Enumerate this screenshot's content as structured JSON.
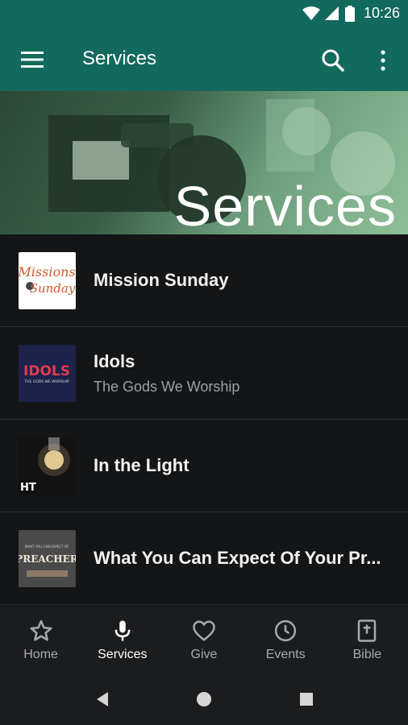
{
  "status_bar": {
    "time": "10:26"
  },
  "app_bar": {
    "title": "Services"
  },
  "hero": {
    "title": "Services"
  },
  "services": [
    {
      "title": "Mission Sunday",
      "subtitle": "",
      "thumb_text": "Missions Sunday",
      "thumb_bg": "#ffffff"
    },
    {
      "title": "Idols",
      "subtitle": "The Gods We Worship",
      "thumb_text": "IDOLS",
      "thumb_sub": "THE GODS WE WORSHIP",
      "thumb_bg": "#1c2249"
    },
    {
      "title": "In the Light",
      "subtitle": "",
      "thumb_text": "HT",
      "thumb_bg": "#121212"
    },
    {
      "title": "What You Can Expect Of Your Pr...",
      "subtitle": "",
      "thumb_text": "PREACHER",
      "thumb_bg": "#3a3a3a"
    }
  ],
  "bottom_nav": [
    {
      "label": "Home",
      "icon": "star-icon",
      "active": false
    },
    {
      "label": "Services",
      "icon": "microphone-icon",
      "active": true
    },
    {
      "label": "Give",
      "icon": "heart-icon",
      "active": false
    },
    {
      "label": "Events",
      "icon": "clock-icon",
      "active": false
    },
    {
      "label": "Bible",
      "icon": "bible-icon",
      "active": false
    }
  ],
  "colors": {
    "primary": "#126a5c",
    "background": "#141517"
  }
}
